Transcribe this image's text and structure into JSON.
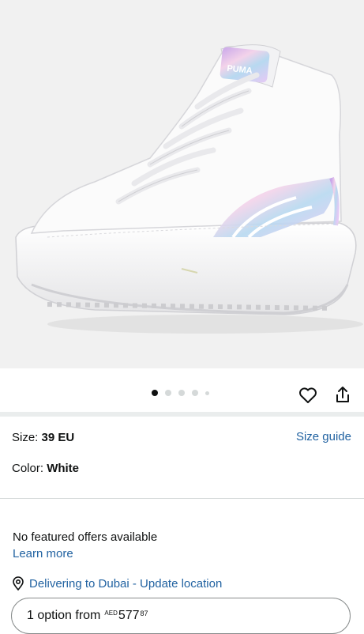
{
  "product_image": {
    "alt": "White high-top platform sneaker with iridescent stripes"
  },
  "carousel": {
    "active_index": 0,
    "count": 5
  },
  "actions": {
    "wishlist_icon": "heart-icon",
    "share_icon": "share-icon"
  },
  "size": {
    "label": "Size: ",
    "value": "39 EU",
    "guide_link": "Size guide"
  },
  "color": {
    "label": "Color: ",
    "value": "White"
  },
  "offers": {
    "message": "No featured offers available",
    "learn_more": "Learn more"
  },
  "delivery": {
    "text": "Delivering to Dubai - Update location",
    "icon": "location-pin-icon"
  },
  "option_button": {
    "label": "1 option from",
    "currency": "AED",
    "whole": "577",
    "fraction": "87"
  },
  "colors": {
    "link": "#2162a1",
    "divider": "#eaeded",
    "active_dot": "#0f1111"
  }
}
